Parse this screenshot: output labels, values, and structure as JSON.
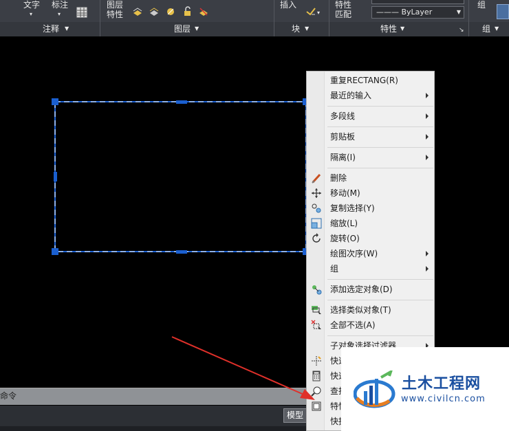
{
  "ribbon": {
    "annotate_panel": {
      "title": "注释",
      "text_label": "文字",
      "dim_label": "标注"
    },
    "layers_panel": {
      "title": "图层",
      "layer_props_label_line1": "图层",
      "layer_props_label_line2": "特性"
    },
    "block_panel": {
      "title": "块",
      "insert_label": "插入"
    },
    "properties_panel": {
      "title": "特性",
      "match_label_line1": "特性",
      "match_label_line2": "匹配",
      "linetype_value": "——— ByLayer"
    },
    "groups_panel": {
      "title": "组",
      "group_label": "组"
    }
  },
  "context_menu": {
    "items": [
      {
        "label": "重复RECTANG(R)",
        "icon": "",
        "submenu": false
      },
      {
        "label": "最近的输入",
        "icon": "",
        "submenu": true
      },
      {
        "label": "多段线",
        "icon": "",
        "submenu": true
      },
      {
        "label": "剪贴板",
        "icon": "",
        "submenu": true
      },
      {
        "label": "隔离(I)",
        "icon": "",
        "submenu": true
      },
      {
        "label": "删除",
        "icon": "eraser-icon",
        "submenu": false
      },
      {
        "label": "移动(M)",
        "icon": "move-icon",
        "submenu": false
      },
      {
        "label": "复制选择(Y)",
        "icon": "copy-icon",
        "submenu": false
      },
      {
        "label": "缩放(L)",
        "icon": "scale-icon",
        "submenu": false
      },
      {
        "label": "旋转(O)",
        "icon": "rotate-icon",
        "submenu": false
      },
      {
        "label": "绘图次序(W)",
        "icon": "",
        "submenu": true
      },
      {
        "label": "组",
        "icon": "",
        "submenu": true
      },
      {
        "label": "添加选定对象(D)",
        "icon": "add-selected-icon",
        "submenu": false
      },
      {
        "label": "选择类似对象(T)",
        "icon": "select-similar-icon",
        "submenu": false
      },
      {
        "label": "全部不选(A)",
        "icon": "deselect-all-icon",
        "submenu": false
      },
      {
        "label": "子对象选择过滤器",
        "icon": "",
        "submenu": true
      },
      {
        "label": "快速选择",
        "icon": "quick-select-icon",
        "submenu": false
      },
      {
        "label": "快速计算器",
        "icon": "calculator-icon",
        "submenu": false
      },
      {
        "label": "查找",
        "icon": "find-icon",
        "submenu": false
      },
      {
        "label": "特性",
        "icon": "properties-icon",
        "submenu": false
      },
      {
        "label": "快捷特性",
        "icon": "",
        "submenu": false
      }
    ]
  },
  "command_line": {
    "label": "命令"
  },
  "status_bar": {
    "model_tab": "模型"
  },
  "watermark": {
    "name": "土木工程网",
    "url": "www.civilcn.com"
  },
  "colors": {
    "ribbon_bg": "#3b3e45",
    "canvas_bg": "#000000",
    "selection_blue": "#1e63d6",
    "grip_blue": "#1a5fd0",
    "menu_bg": "#f0f0f0",
    "arrow_red": "#e0302a",
    "watermark_blue": "#1a4fa0"
  }
}
